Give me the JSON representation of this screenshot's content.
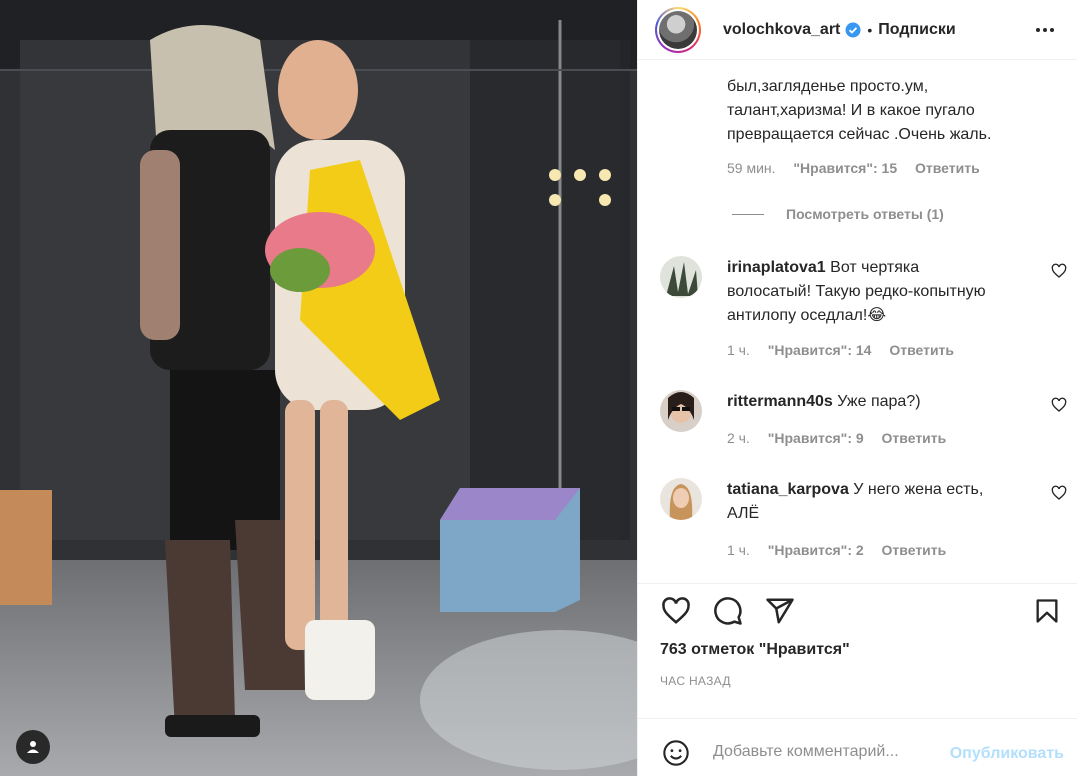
{
  "post": {
    "username": "volochkova_art",
    "verified": true,
    "separator": "•",
    "follow_label": "Подписки",
    "more_icon": "more-horizontal-icon"
  },
  "top_comment": {
    "lines": [
      "был,загляденье просто.ум,",
      "талант,харизма! И в какое пугало",
      "превращается сейчас .Очень жаль."
    ],
    "time": "59 мин.",
    "likes": "\"Нравится\": 15",
    "reply": "Ответить",
    "view_replies": "Посмотреть ответы (1)"
  },
  "comments": [
    {
      "username": "irinaplatova1",
      "text": "Вот чертяка волосатый! Такую редко-копытную антилопу оседлал!😂",
      "time": "1 ч.",
      "likes": "\"Нравится\": 14",
      "reply": "Ответить"
    },
    {
      "username": "rittermann40s",
      "text": "Уже пара?)",
      "time": "2 ч.",
      "likes": "\"Нравится\": 9",
      "reply": "Ответить"
    },
    {
      "username": "tatiana_karpova",
      "text": "У него жена есть, АЛЁ",
      "time": "1 ч.",
      "likes": "\"Нравится\": 2",
      "reply": "Ответить"
    }
  ],
  "actions": {
    "like_icon": "heart-icon",
    "comment_icon": "comment-icon",
    "share_icon": "share-icon",
    "save_icon": "bookmark-icon",
    "likes_count": "763 отметок \"Нравится\"",
    "time_ago": "ЧАС НАЗАД"
  },
  "add_comment": {
    "placeholder": "Добавьте комментарий...",
    "publish_label": "Опубликовать"
  },
  "colors": {
    "verified": "#3897f0",
    "muted": "#8e8e8e",
    "text": "#262626",
    "publish_disabled": "#b2dffc",
    "border": "#efefef"
  }
}
